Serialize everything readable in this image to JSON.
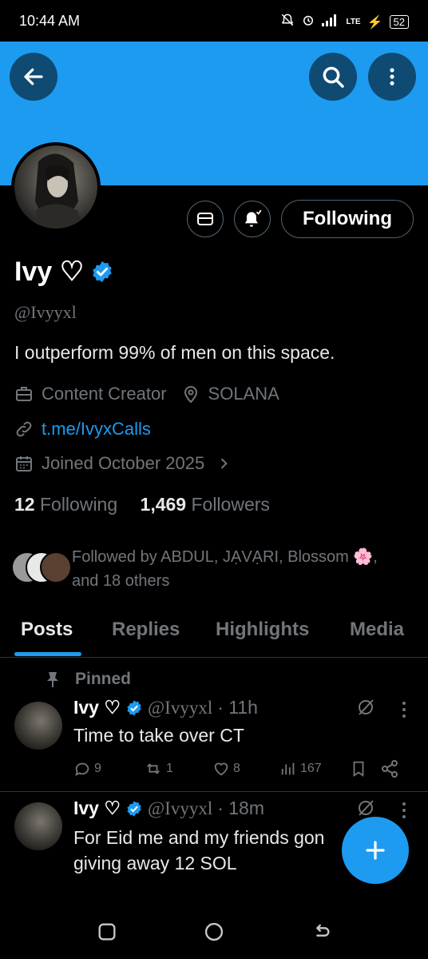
{
  "status_bar": {
    "time": "10:44 AM",
    "battery": "52",
    "network": "LTE"
  },
  "profile": {
    "name": "Ivy ♡",
    "handle": "@Ivyyxl",
    "bio": "I outperform 99% of men on this space.",
    "category": "Content Creator",
    "location": "SOLANA",
    "link": "t.me/IvyxCalls",
    "joined": "Joined October 2025",
    "following_count": "12",
    "following_label": "Following",
    "followers_count": "1,469",
    "followers_label": "Followers",
    "followed_by_line1": "Followed by ABDUL, JẠVẠRI, Blossom 🌸,",
    "followed_by_line2": "and 18 others",
    "follow_button": "Following"
  },
  "tabs": [
    {
      "label": "Posts",
      "active": true
    },
    {
      "label": "Replies",
      "active": false
    },
    {
      "label": "Highlights",
      "active": false
    },
    {
      "label": "Media",
      "active": false
    }
  ],
  "tweets": [
    {
      "pinned_label": "Pinned",
      "name": "Ivy ♡",
      "handle": "@Ivyyxl",
      "time": "· 11h",
      "text": "Time to take over CT",
      "replies": "9",
      "retweets": "1",
      "likes": "8",
      "views": "167"
    },
    {
      "name": "Ivy ♡",
      "handle": "@Ivyyxl",
      "time": "· 18m",
      "text_line1": "For Eid me and my friends gon",
      "text_line2": "giving away 12 SOL"
    }
  ],
  "colors": {
    "accent": "#1d9bf0",
    "background": "#000000",
    "muted": "#71767b"
  }
}
